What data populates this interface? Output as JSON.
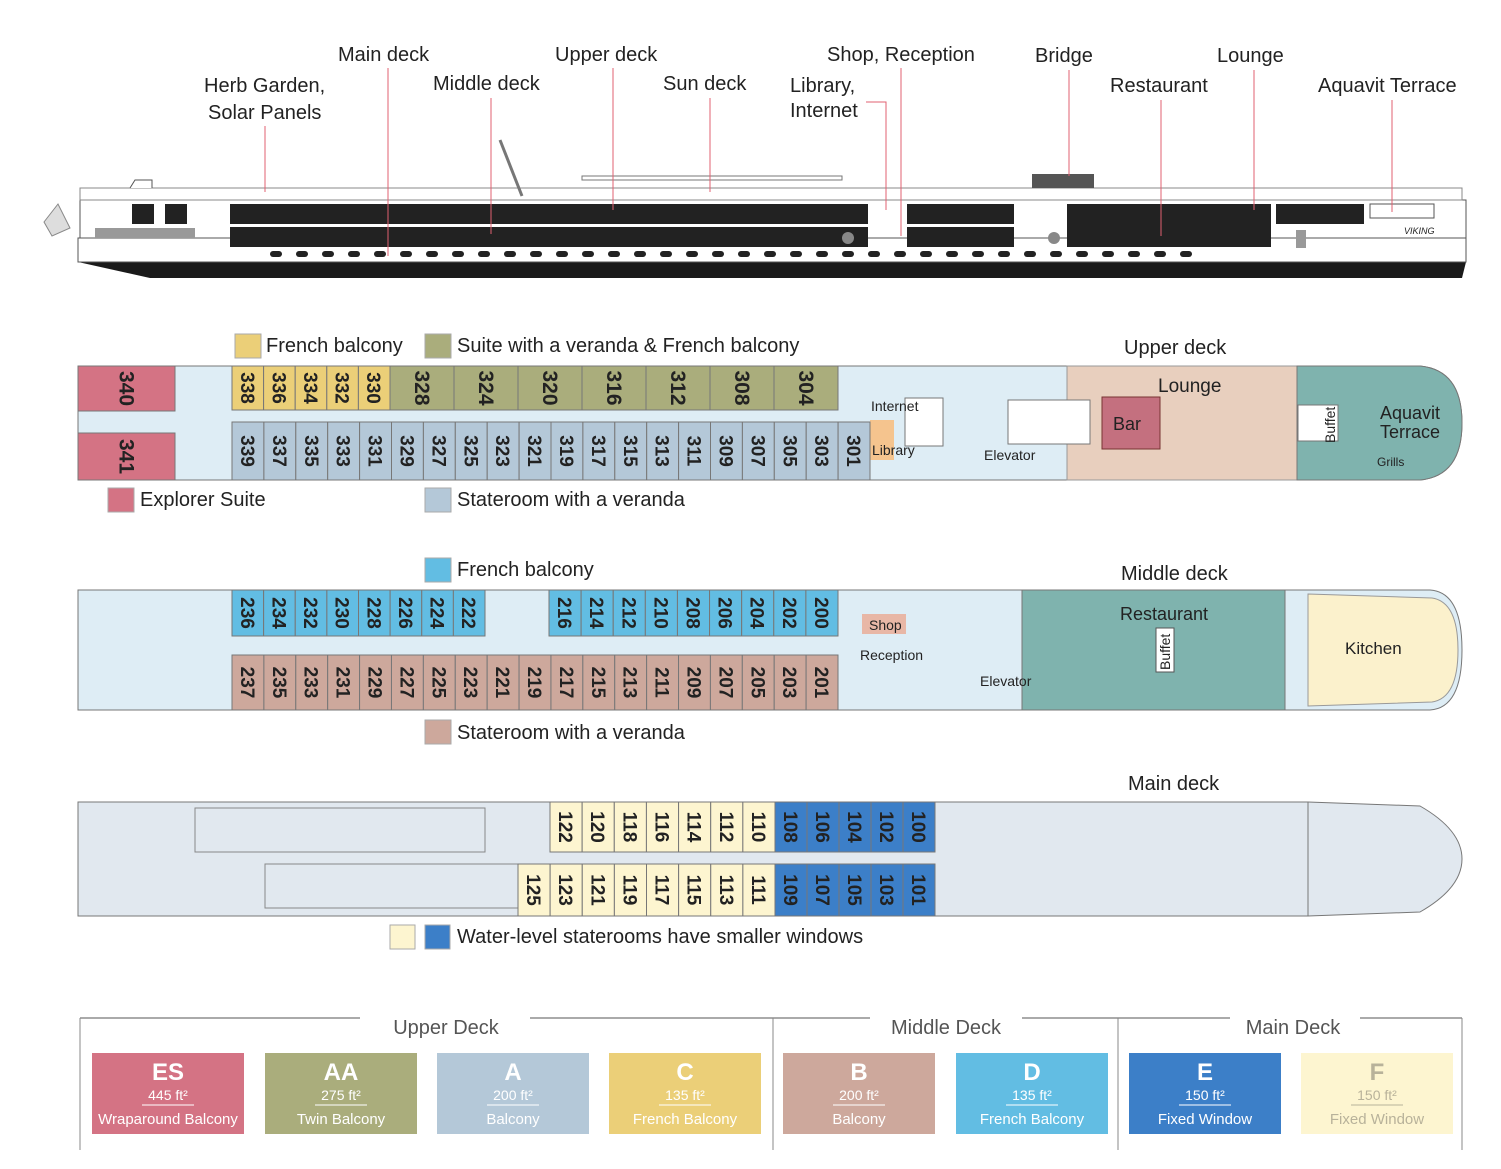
{
  "colors": {
    "ES": "#d47384",
    "AA": "#aaad7c",
    "A": "#b4c8d8",
    "C": "#ebcf78",
    "B": "#cda89c",
    "D": "#62bde3",
    "E": "#3c7fc8",
    "F": "#fdf5d0",
    "public": "#deedf5",
    "lounge": "#e8cfbe",
    "teal": "#7fb3ae",
    "kitchen": "#fbf1cc",
    "maindeck": "#e1e8ef"
  },
  "profile_labels": [
    "Herb Garden,",
    "Solar Panels",
    "Main deck",
    "Middle deck",
    "Upper deck",
    "Sun deck",
    "Library,",
    "Internet",
    "Shop, Reception",
    "Bridge",
    "Restaurant",
    "Lounge",
    "Aquavit Terrace"
  ],
  "profile_logo": "VIKING",
  "upper": {
    "title": "Upper deck",
    "legend": [
      "French balcony",
      "Suite with a veranda & French balcony",
      "Explorer Suite",
      "Stateroom with a veranda"
    ],
    "es": [
      "340",
      "341"
    ],
    "c": [
      "338",
      "336",
      "334",
      "332",
      "330"
    ],
    "aa": [
      "328",
      "324",
      "320",
      "316",
      "312",
      "308",
      "304"
    ],
    "a": [
      "339",
      "337",
      "335",
      "333",
      "331",
      "329",
      "327",
      "325",
      "323",
      "321",
      "319",
      "317",
      "315",
      "313",
      "311",
      "309",
      "307",
      "305",
      "303",
      "301"
    ],
    "rooms": [
      "Internet",
      "Library",
      "Elevator",
      "Lounge",
      "Bar",
      "Buffet",
      "Aquavit",
      "Terrace",
      "Grills"
    ]
  },
  "middle": {
    "title": "Middle deck",
    "legend": [
      "French balcony",
      "Stateroom with a veranda"
    ],
    "d1": [
      "236",
      "234",
      "232",
      "230",
      "228",
      "226",
      "224",
      "222"
    ],
    "d2": [
      "216",
      "214",
      "212",
      "210",
      "208",
      "206",
      "204",
      "202",
      "200"
    ],
    "b": [
      "237",
      "235",
      "233",
      "231",
      "229",
      "227",
      "225",
      "223",
      "221",
      "219",
      "217",
      "215",
      "213",
      "211",
      "209",
      "207",
      "205",
      "203",
      "201"
    ],
    "rooms": [
      "Shop",
      "Reception",
      "Elevator",
      "Restaurant",
      "Buffet",
      "Kitchen"
    ]
  },
  "main": {
    "title": "Main deck",
    "legend": "Water-level staterooms have smaller windows",
    "f_top": [
      "122",
      "120",
      "118",
      "116",
      "114",
      "112",
      "110"
    ],
    "e_top": [
      "108",
      "106",
      "104",
      "102",
      "100"
    ],
    "f_bot": [
      "125",
      "123",
      "121",
      "119",
      "117",
      "115",
      "113",
      "111"
    ],
    "e_bot": [
      "109",
      "107",
      "105",
      "103",
      "101"
    ]
  },
  "categories": {
    "groups": [
      "Upper Deck",
      "Middle Deck",
      "Main Deck"
    ],
    "items": [
      {
        "code": "ES",
        "size": "445 ft²",
        "type": "Wraparound Balcony",
        "color": "#d47384",
        "text": "#fff"
      },
      {
        "code": "AA",
        "size": "275 ft²",
        "type": "Twin Balcony",
        "color": "#aaad7c",
        "text": "#fff"
      },
      {
        "code": "A",
        "size": "200 ft²",
        "type": "Balcony",
        "color": "#b4c8d8",
        "text": "#fff"
      },
      {
        "code": "C",
        "size": "135 ft²",
        "type": "French Balcony",
        "color": "#ebcf78",
        "text": "#fff"
      },
      {
        "code": "B",
        "size": "200 ft²",
        "type": "Balcony",
        "color": "#cda89c",
        "text": "#fff"
      },
      {
        "code": "D",
        "size": "135 ft²",
        "type": "French Balcony",
        "color": "#62bde3",
        "text": "#fff"
      },
      {
        "code": "E",
        "size": "150 ft²",
        "type": "Fixed Window",
        "color": "#3c7fc8",
        "text": "#fff"
      },
      {
        "code": "F",
        "size": "150 ft²",
        "type": "Fixed Window",
        "color": "#fdf5d0",
        "text": "#b8b29a"
      }
    ]
  }
}
